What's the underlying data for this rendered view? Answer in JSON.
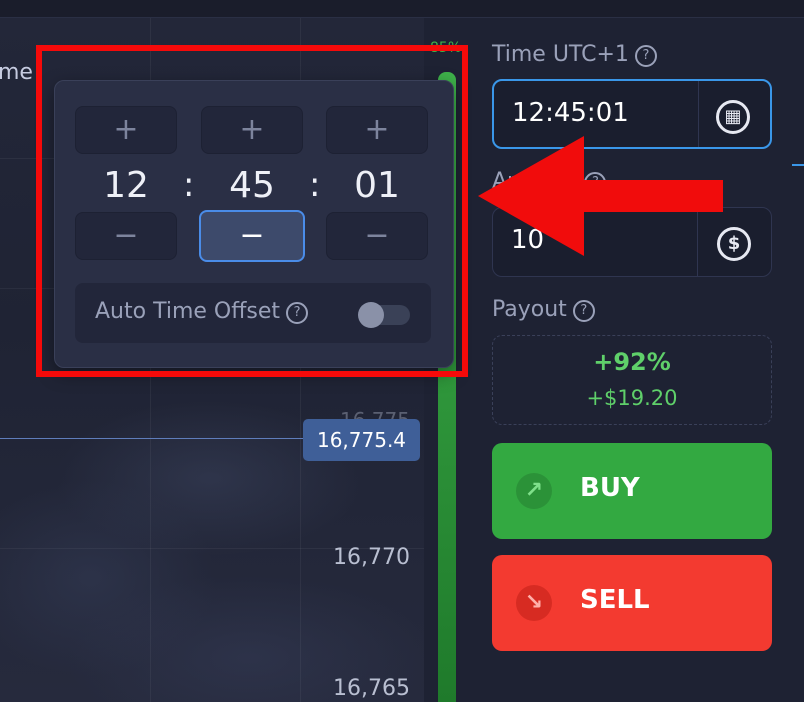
{
  "chart": {
    "left_label": "me",
    "corner_pct": "85%",
    "current_price": "16,775.4",
    "ghost_tick": "16,775",
    "y_ticks": [
      "16,770",
      "16,765"
    ]
  },
  "time_picker": {
    "hours": "12",
    "minutes": "45",
    "seconds": "01",
    "separator": ":",
    "plus_label": "+",
    "minus_label": "−",
    "auto_offset_label": "Auto Time Offset",
    "auto_offset_enabled": false
  },
  "panel": {
    "time_label": "Time UTC+1",
    "time_value": "12:45:01",
    "amount_label": "Amount",
    "amount_value": "10",
    "payout_label": "Payout",
    "payout_pct": "+92%",
    "payout_amount": "+$19.20",
    "buy_label": "BUY",
    "sell_label": "SELL"
  },
  "icons": {
    "help": "?",
    "calendar": "▦",
    "dollar": "$",
    "buy_arrow": "↗",
    "sell_arrow": "↘"
  },
  "colors": {
    "buy": "#33a941",
    "sell": "#f33a30",
    "accent": "#3a97e9",
    "payout": "#5fd06a",
    "annotation": "#f10c0c"
  }
}
